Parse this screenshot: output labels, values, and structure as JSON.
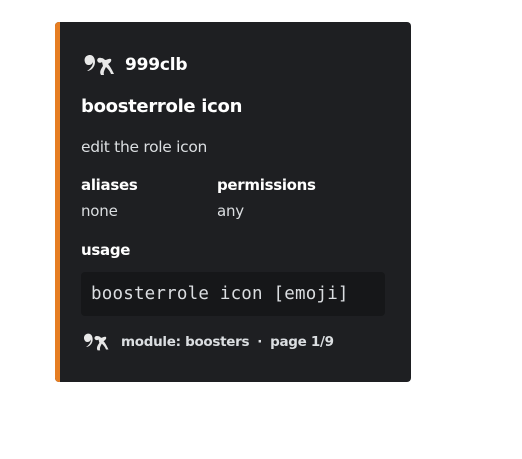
{
  "colors": {
    "accent": "#e67e22",
    "embed_background": "#1e1f22",
    "code_background": "#161719"
  },
  "embed": {
    "author": {
      "icon": "bot-logo-icon",
      "name": "999clb"
    },
    "title": "boosterrole icon",
    "description": "edit the role icon",
    "fields": [
      {
        "name": "aliases",
        "value": "none"
      },
      {
        "name": "permissions",
        "value": "any"
      },
      {
        "name": "usage"
      }
    ],
    "usage_code": "boosterrole icon [emoji]",
    "footer": {
      "icon": "bot-logo-icon",
      "module": "module: boosters",
      "separator": "·",
      "page": "page 1/9"
    }
  }
}
